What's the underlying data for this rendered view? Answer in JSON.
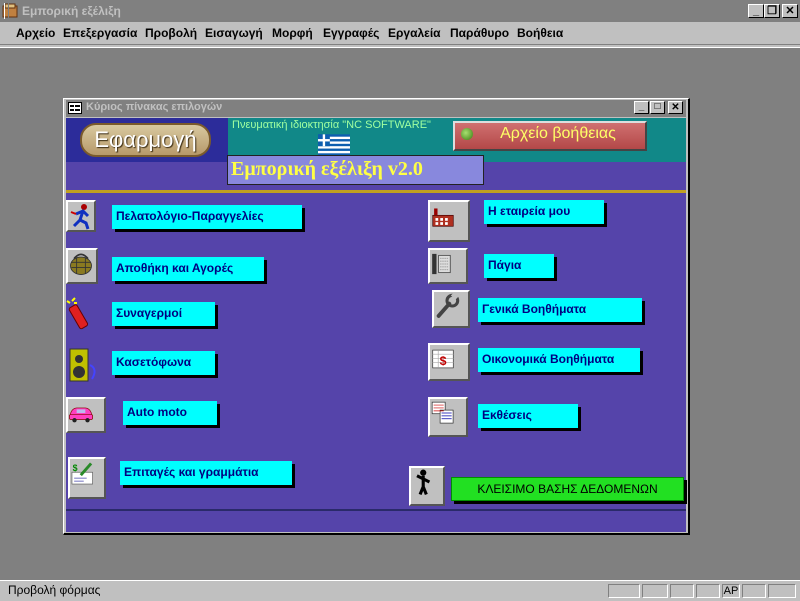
{
  "window": {
    "title": "Εμπορική εξέλιξη"
  },
  "menubar": {
    "items": [
      {
        "label": "Αρχείο"
      },
      {
        "label": "Επεξεργασία"
      },
      {
        "label": "Προβολή"
      },
      {
        "label": "Εισαγωγή"
      },
      {
        "label": "Μορφή"
      },
      {
        "label": "Εγγραφές"
      },
      {
        "label": "Εργαλεία"
      },
      {
        "label": "Παράθυρο"
      },
      {
        "label": "Βοήθεια"
      }
    ]
  },
  "form": {
    "title": "Κύριος πίνακας επιλογών",
    "app_button": "Εφαρμογή",
    "copyright": "Πνευματική ιδιοκτησία \"NC SOFTWARE\"",
    "help_button": "Αρχείο βοήθειας",
    "app_title": "Εμπορική εξέλιξη  v2.0",
    "left_items": [
      {
        "label": "Πελατολόγιο-Παραγγελίες",
        "icon": "running-man-icon"
      },
      {
        "label": "Αποθήκη και Αγορές",
        "icon": "basket-icon"
      },
      {
        "label": "Συναγερμοί",
        "icon": "dynamite-icon"
      },
      {
        "label": "Κασετόφωνα",
        "icon": "speaker-icon"
      },
      {
        "label": "Auto moto",
        "icon": "car-icon"
      },
      {
        "label": "Επιταγές και γραμμάτια",
        "icon": "check-pen-icon"
      }
    ],
    "right_items": [
      {
        "label": "Η εταιρεία μου",
        "icon": "factory-icon"
      },
      {
        "label": "Πάγια",
        "icon": "cabinet-icon"
      },
      {
        "label": "Γενικά Βοηθήματα",
        "icon": "wrench-icon"
      },
      {
        "label": "Οικονομικά Βοηθήματα",
        "icon": "dollar-ledger-icon"
      },
      {
        "label": "Εκθέσεις",
        "icon": "reports-icon"
      }
    ],
    "exit_button": "ΚΛΕΙΣΙΜΟ ΒΑΣΗΣ ΔΕΔΟΜΕΝΩΝ"
  },
  "statusbar": {
    "text": "Προβολή φόρμας",
    "indicator": "ΑΡ"
  },
  "colors": {
    "form_background": "#5544aa",
    "label_background": "#00ffff",
    "exit_background": "#22e022",
    "title_text": "#ffff44"
  }
}
